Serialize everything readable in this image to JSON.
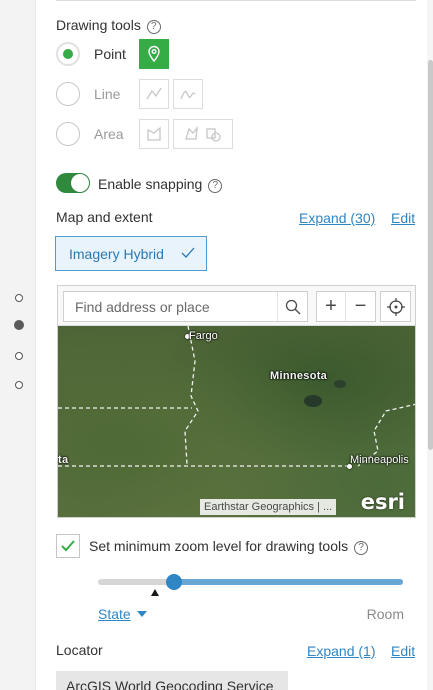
{
  "drawing_tools": {
    "title": "Drawing tools",
    "help_icon": "question-circle-icon",
    "tools": [
      {
        "label": "Point",
        "selected": true,
        "enabled": true,
        "icons": [
          "map-pin-icon"
        ]
      },
      {
        "label": "Line",
        "selected": false,
        "enabled": false,
        "icons": [
          "polyline-icon",
          "freehand-line-icon"
        ]
      },
      {
        "label": "Area",
        "selected": false,
        "enabled": false,
        "icons": [
          "polygon-icon",
          "freehand-polygon-icon",
          "multi-area-icon"
        ]
      }
    ]
  },
  "snapping": {
    "label": "Enable snapping",
    "enabled": true
  },
  "map_extent": {
    "title": "Map and extent",
    "expand_link": "Expand (30)",
    "edit_link": "Edit",
    "basemap": "Imagery Hybrid"
  },
  "map": {
    "search_placeholder": "Find address or place",
    "zoom_in": "+",
    "zoom_out": "−",
    "labels": {
      "fargo": "Fargo",
      "minnesota": "Minnesota",
      "state_partial": "ta",
      "minneapolis": "Minneapolis"
    },
    "attribution": "Earthstar Geographics | ...",
    "logo": "esri"
  },
  "min_zoom": {
    "label": "Set minimum zoom level for drawing tools",
    "checked": true,
    "level_value": "State",
    "max_label": "Room",
    "slider_fraction": 0.25
  },
  "locator": {
    "title": "Locator",
    "expand_link": "Expand (1)",
    "edit_link": "Edit",
    "service": "ArcGIS World Geocoding Service"
  },
  "colors": {
    "accent_green": "#35ac46",
    "toggle_green": "#2f8a3e",
    "link_blue": "#2f86c4"
  }
}
